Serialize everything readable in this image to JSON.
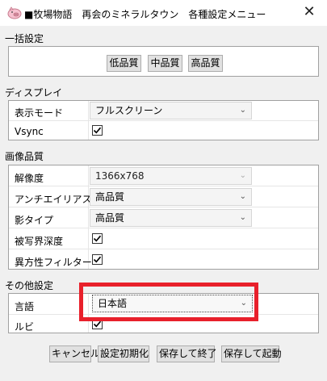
{
  "window": {
    "title": "■牧場物語　再会のミネラルタウン　各種設定メニュー",
    "close_glyph": "✕"
  },
  "batch": {
    "label": "一括設定",
    "buttons": [
      "低品質",
      "中品質",
      "高品質"
    ]
  },
  "display": {
    "label": "ディスプレイ",
    "mode_label": "表示モード",
    "mode_value": "フルスクリーン",
    "vsync_label": "Vsync",
    "vsync_checked": true
  },
  "quality": {
    "label": "画像品質",
    "resolution_label": "解像度",
    "resolution_value": "1366x768",
    "aa_label": "アンチエイリアス",
    "aa_value": "高品質",
    "shadow_label": "影タイプ",
    "shadow_value": "高品質",
    "dof_label": "被写界深度",
    "dof_checked": true,
    "aniso_label": "異方性フィルター",
    "aniso_checked": true
  },
  "other": {
    "label": "その他設定",
    "language_label": "言語",
    "language_value": "日本語",
    "ruby_label": "ルビ",
    "ruby_checked": true
  },
  "footer": {
    "cancel": "キャンセル",
    "reset": "設定初期化",
    "save_exit": "保存して終了",
    "save_launch": "保存して起動"
  },
  "colors": {
    "highlight": "#e8202b",
    "background": "#f0f0f0"
  }
}
